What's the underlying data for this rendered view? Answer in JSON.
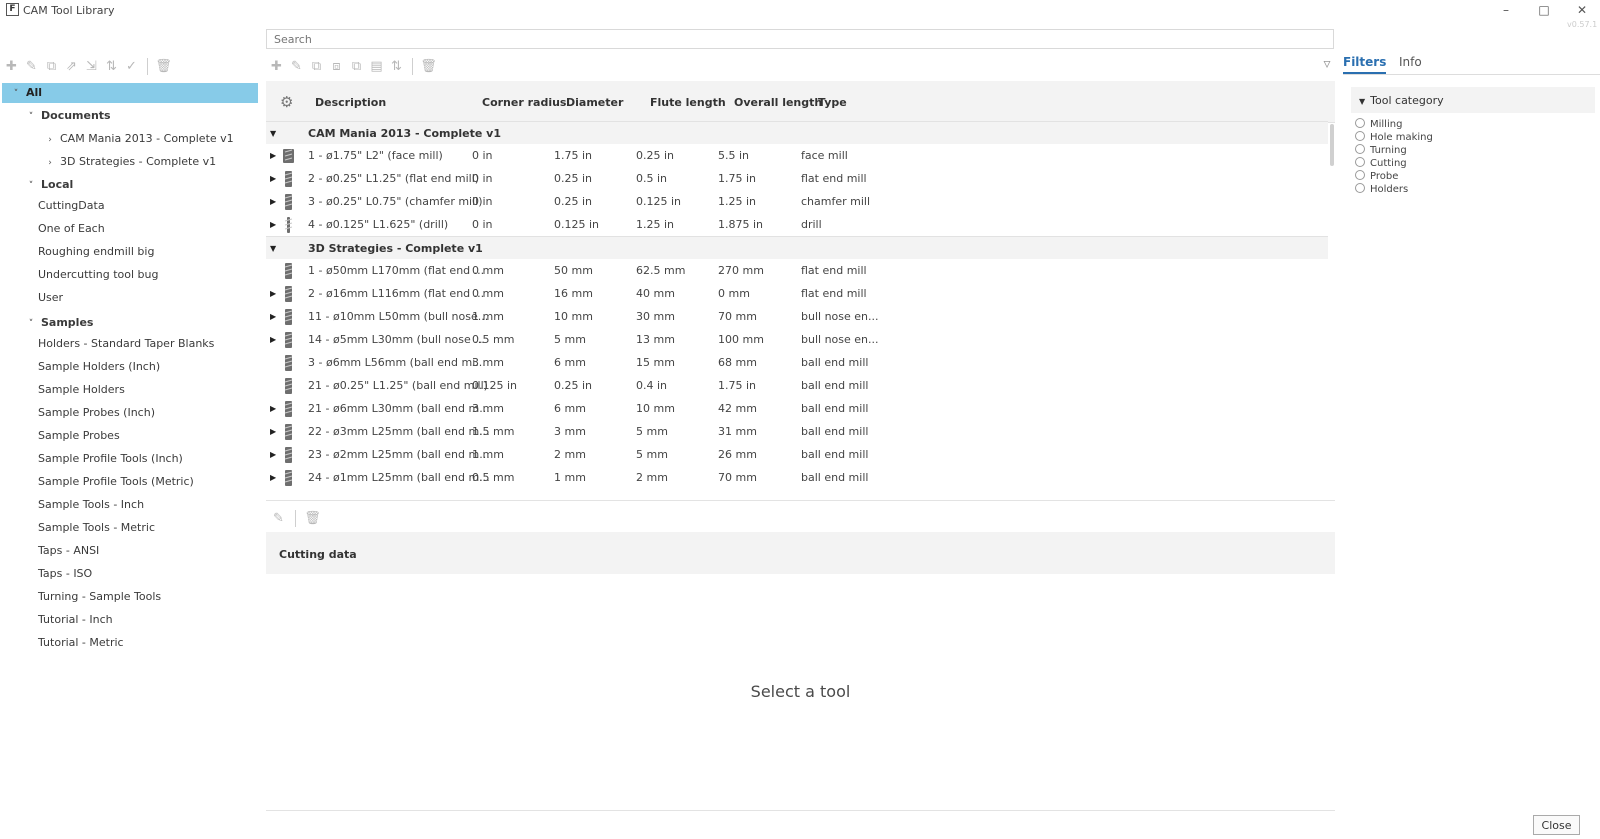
{
  "window": {
    "title": "CAM Tool Library",
    "logo": "F",
    "version": "v0.57.1"
  },
  "search": {
    "placeholder": "Search"
  },
  "left_tree": [
    {
      "label": "All",
      "level": 0,
      "expanded": true,
      "selected": true,
      "bold": true
    },
    {
      "label": "Documents",
      "level": 1,
      "expanded": true,
      "bold": true
    },
    {
      "label": "CAM Mania 2013 - Complete v1",
      "level": 2,
      "collapsed": true
    },
    {
      "label": "3D Strategies - Complete v1",
      "level": 2,
      "collapsed": true
    },
    {
      "label": "Local",
      "level": 1,
      "expanded": true,
      "bold": true
    },
    {
      "label": "CuttingData",
      "level": 2
    },
    {
      "label": "One of Each",
      "level": 2
    },
    {
      "label": "Roughing endmill big",
      "level": 2
    },
    {
      "label": "Undercutting tool bug",
      "level": 2
    },
    {
      "label": "User",
      "level": 2
    },
    {
      "label": "Samples",
      "level": 1,
      "expanded": true,
      "bold": true
    },
    {
      "label": "Holders - Standard Taper Blanks",
      "level": 2
    },
    {
      "label": "Sample Holders (Inch)",
      "level": 2
    },
    {
      "label": "Sample Holders",
      "level": 2
    },
    {
      "label": "Sample Probes (Inch)",
      "level": 2
    },
    {
      "label": "Sample Probes",
      "level": 2
    },
    {
      "label": "Sample Profile Tools (Inch)",
      "level": 2
    },
    {
      "label": "Sample Profile Tools (Metric)",
      "level": 2
    },
    {
      "label": "Sample Tools - Inch",
      "level": 2
    },
    {
      "label": "Sample Tools - Metric",
      "level": 2
    },
    {
      "label": "Taps - ANSI",
      "level": 2
    },
    {
      "label": "Taps - ISO",
      "level": 2
    },
    {
      "label": "Turning - Sample Tools",
      "level": 2
    },
    {
      "label": "Tutorial - Inch",
      "level": 2
    },
    {
      "label": "Tutorial - Metric",
      "level": 2
    }
  ],
  "table": {
    "columns": [
      "Description",
      "Corner radius",
      "Diameter",
      "Flute length",
      "Overall length",
      "Type"
    ],
    "groups": [
      {
        "name": "CAM Mania 2013 - Complete v1",
        "rows": [
          {
            "expandable": true,
            "icon": "face-mill-icon",
            "cells": [
              "1 - ø1.75\" L2\" (face mill)",
              "0 in",
              "1.75 in",
              "0.25 in",
              "5.5 in",
              "face mill"
            ]
          },
          {
            "expandable": true,
            "icon": "flat-end-mill-icon",
            "cells": [
              "2 - ø0.25\" L1.25\" (flat end mill)",
              "0 in",
              "0.25 in",
              "0.5 in",
              "1.75 in",
              "flat end mill"
            ]
          },
          {
            "expandable": true,
            "icon": "chamfer-mill-icon",
            "cells": [
              "3 - ø0.25\" L0.75\" (chamfer mill)",
              "0 in",
              "0.25 in",
              "0.125 in",
              "1.25 in",
              "chamfer mill"
            ]
          },
          {
            "expandable": true,
            "icon": "drill-icon",
            "cells": [
              "4 - ø0.125\" L1.625\" (drill)",
              "0 in",
              "0.125 in",
              "1.25 in",
              "1.875 in",
              "drill"
            ]
          }
        ]
      },
      {
        "name": "3D Strategies - Complete v1",
        "rows": [
          {
            "expandable": false,
            "icon": "flat-end-mill-icon",
            "cells": [
              "1 - ø50mm L170mm (flat end ...",
              "0 mm",
              "50 mm",
              "62.5 mm",
              "270 mm",
              "flat end mill"
            ]
          },
          {
            "expandable": true,
            "icon": "flat-end-mill-icon",
            "cells": [
              "2 - ø16mm L116mm (flat end ...",
              "0 mm",
              "16 mm",
              "40 mm",
              "0 mm",
              "flat end mill"
            ]
          },
          {
            "expandable": true,
            "icon": "bull-nose-mill-icon",
            "cells": [
              "11 - ø10mm L50mm (bull nose...",
              "1 mm",
              "10 mm",
              "30 mm",
              "70 mm",
              "bull nose en..."
            ]
          },
          {
            "expandable": true,
            "icon": "bull-nose-mill-icon",
            "cells": [
              "14 - ø5mm L30mm (bull nose ...",
              "0.5 mm",
              "5 mm",
              "13 mm",
              "100 mm",
              "bull nose en..."
            ]
          },
          {
            "expandable": false,
            "icon": "ball-end-mill-icon",
            "cells": [
              "3 - ø6mm L56mm (ball end mi...",
              "3 mm",
              "6 mm",
              "15 mm",
              "68 mm",
              "ball end mill"
            ]
          },
          {
            "expandable": false,
            "icon": "ball-end-mill-icon",
            "cells": [
              "21 - ø0.25\" L1.25\" (ball end mill)",
              "0.125 in",
              "0.25 in",
              "0.4 in",
              "1.75 in",
              "ball end mill"
            ]
          },
          {
            "expandable": true,
            "icon": "ball-end-mill-icon",
            "cells": [
              "21 - ø6mm L30mm (ball end m...",
              "3 mm",
              "6 mm",
              "10 mm",
              "42 mm",
              "ball end mill"
            ]
          },
          {
            "expandable": true,
            "icon": "ball-end-mill-icon",
            "cells": [
              "22 - ø3mm L25mm (ball end m...",
              "1.5 mm",
              "3 mm",
              "5 mm",
              "31 mm",
              "ball end mill"
            ]
          },
          {
            "expandable": true,
            "icon": "ball-end-mill-icon",
            "cells": [
              "23 - ø2mm L25mm (ball end m...",
              "1 mm",
              "2 mm",
              "5 mm",
              "26 mm",
              "ball end mill"
            ]
          },
          {
            "expandable": true,
            "icon": "ball-end-mill-icon",
            "cells": [
              "24 - ø1mm L25mm (ball end m...",
              "0.5 mm",
              "1 mm",
              "2 mm",
              "70 mm",
              "ball end mill"
            ]
          }
        ]
      }
    ]
  },
  "cutting_data": {
    "title": "Cutting data",
    "empty_message": "Select a tool"
  },
  "right_panel": {
    "tabs": [
      {
        "label": "Filters",
        "active": true
      },
      {
        "label": "Info",
        "active": false
      }
    ],
    "category_title": "Tool category",
    "categories": [
      "Milling",
      "Hole making",
      "Turning",
      "Cutting",
      "Probe",
      "Holders"
    ]
  },
  "footer": {
    "close_label": "Close"
  },
  "colors": {
    "selection": "#87cbe8",
    "accent": "#2a6fb0",
    "header_bg": "#f3f3f3"
  }
}
